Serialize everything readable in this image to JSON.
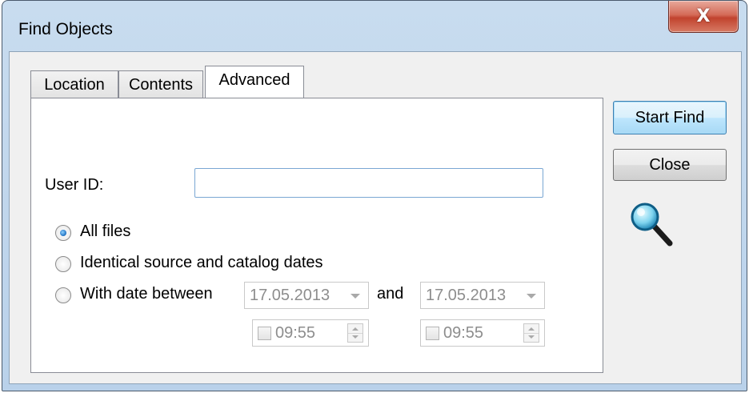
{
  "window": {
    "title": "Find Objects",
    "close_glyph": "X"
  },
  "tabs": [
    {
      "label": "Location",
      "active": false
    },
    {
      "label": "Contents",
      "active": false
    },
    {
      "label": "Advanced",
      "active": true
    }
  ],
  "advanced": {
    "user_id_label": "User ID:",
    "user_id_value": "",
    "options": [
      {
        "label": "All files",
        "checked": true
      },
      {
        "label": "Identical source and catalog dates",
        "checked": false
      },
      {
        "label": "With date between",
        "checked": false
      }
    ],
    "date_from": "17.05.2013",
    "and_label": "and",
    "date_to": "17.05.2013",
    "time_from": "09:55",
    "time_to": "09:55"
  },
  "buttons": {
    "start_find": "Start Find",
    "close": "Close"
  },
  "icons": {
    "magnifier": "magnifier-icon",
    "close": "close-icon"
  },
  "colors": {
    "frame": "#b9d1ea",
    "close_button": "#c1432e",
    "default_button_border": "#3c7fb1",
    "radio_checked": "#1c6fc0"
  }
}
